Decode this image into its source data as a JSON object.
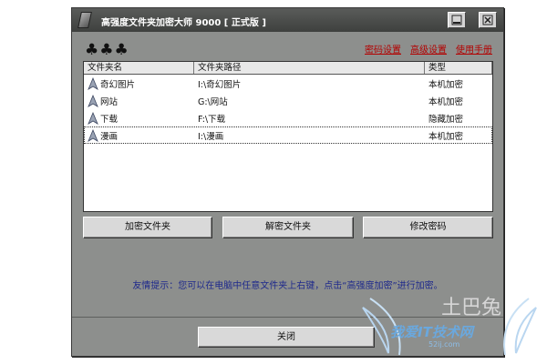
{
  "window": {
    "title": "高强度文件夹加密大师 9000 [ 正式版 ]"
  },
  "logo": {
    "glyphs": "♣♣♣"
  },
  "toplinks": [
    {
      "label": "密码设置"
    },
    {
      "label": "高级设置"
    },
    {
      "label": "使用手册"
    }
  ],
  "list": {
    "columns": [
      "文件夹名",
      "文件夹路径",
      "类型"
    ],
    "rows": [
      {
        "name": "奇幻图片",
        "path": "I:\\奇幻图片",
        "type": "本机加密"
      },
      {
        "name": "网站",
        "path": "G:\\网站",
        "type": "本机加密"
      },
      {
        "name": "下载",
        "path": "F:\\下载",
        "type": "隐藏加密"
      },
      {
        "name": "漫画",
        "path": "I:\\漫画",
        "type": "本机加密"
      }
    ]
  },
  "buttons": {
    "encrypt": "加密文件夹",
    "decrypt": "解密文件夹",
    "change_password": "修改密码",
    "close": "关闭"
  },
  "tip": "友情提示：您可以在电脑中任意文件夹上右键，点击“高强度加密”进行加密。",
  "watermark": {
    "text": "我爱IT技术网",
    "url": "52ij.com",
    "corner": "土巴兔"
  },
  "colors": {
    "window_bg": "#8d8f8d",
    "titlebar": "#4a4c4a",
    "link_red": "#b30000",
    "tip_blue": "#1f2a8c"
  }
}
